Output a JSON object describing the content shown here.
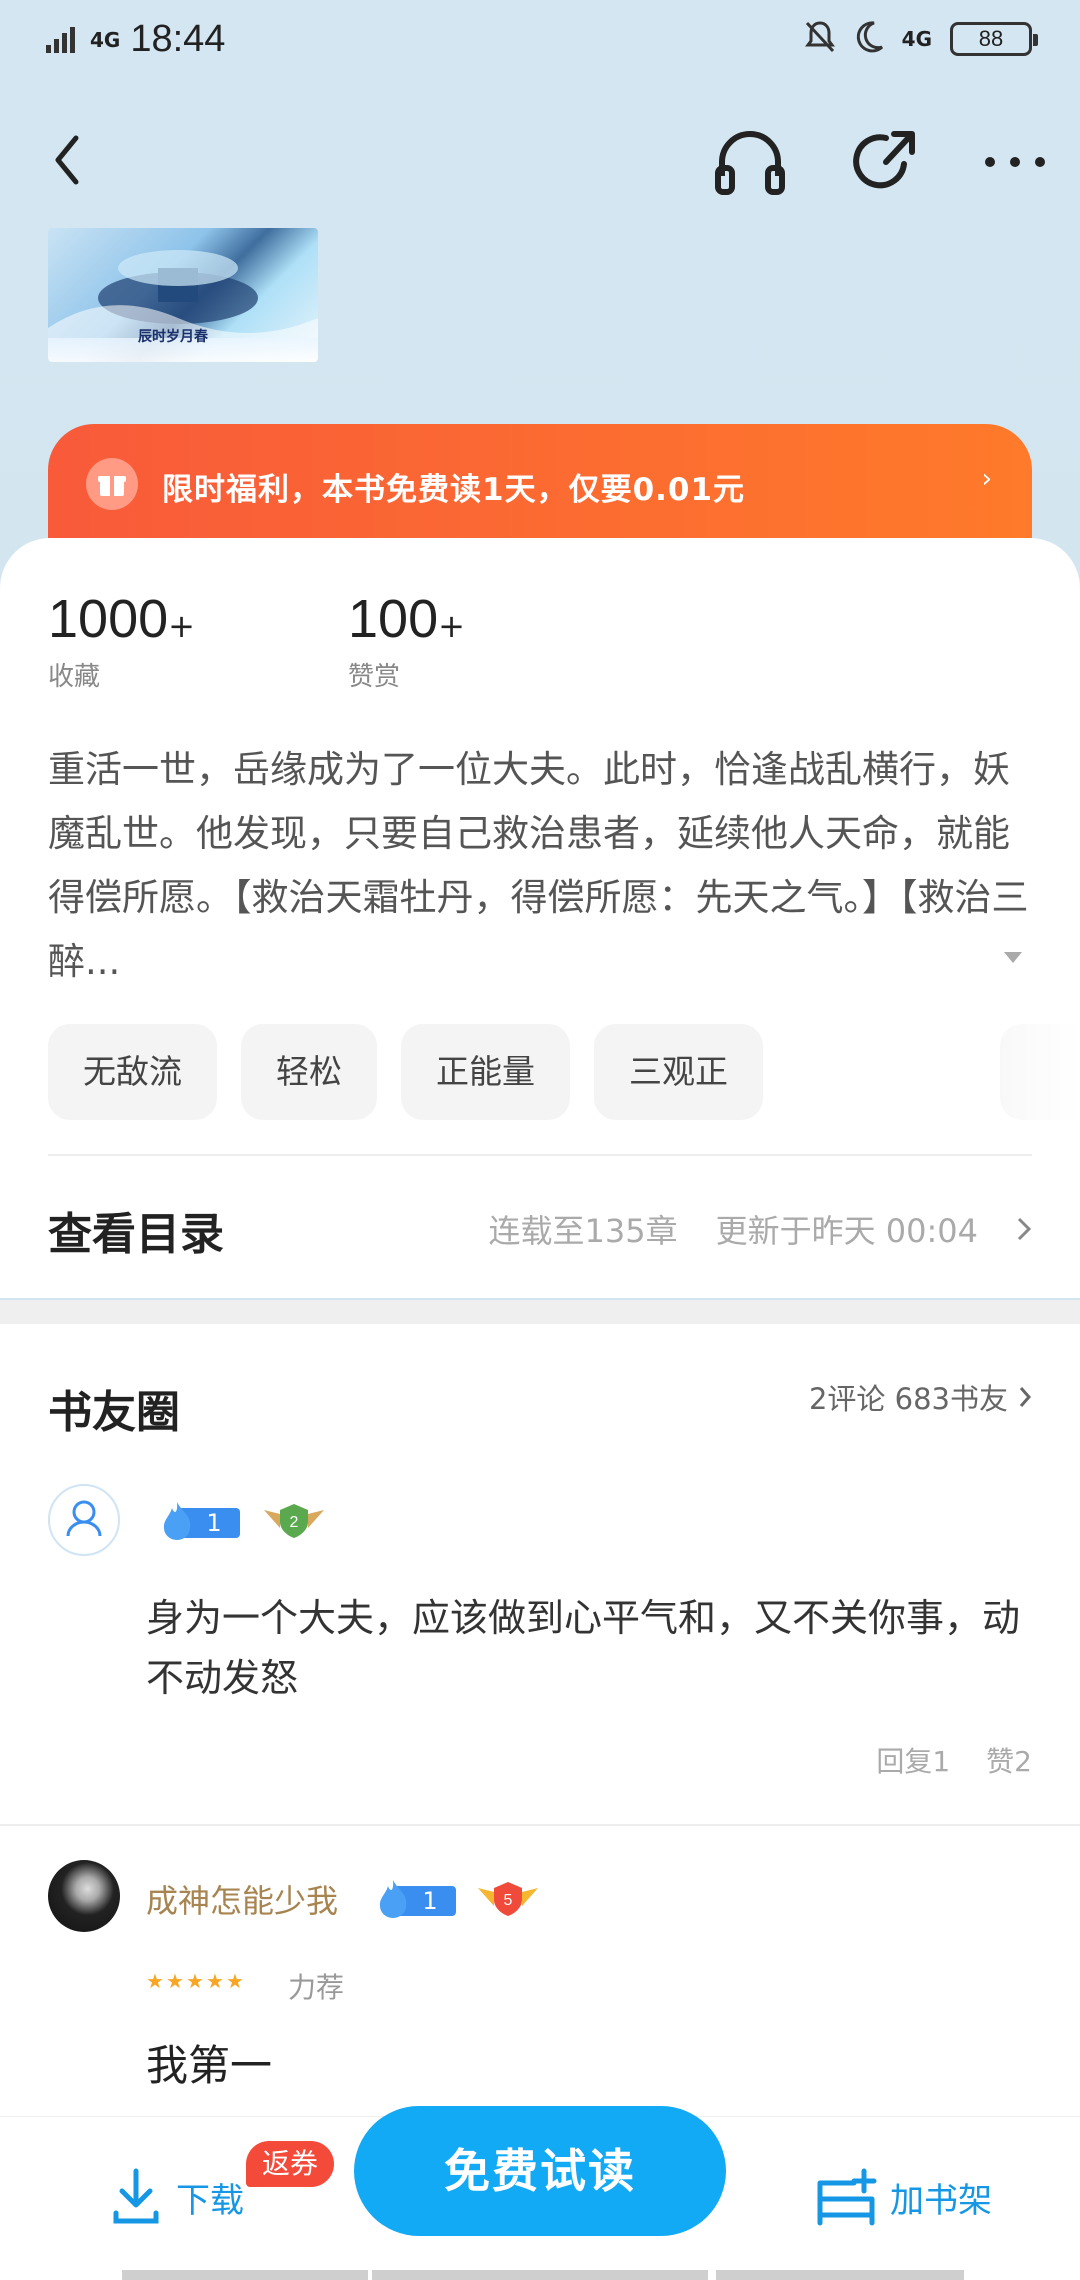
{
  "status_bar": {
    "network_left": "4G",
    "time": "18:44",
    "network_right": "4G",
    "battery": "88"
  },
  "nav": {
    "back_icon": "chevron-left-icon",
    "audio_icon": "headphones-icon",
    "share_icon": "share-icon",
    "more_icon": "more-icon"
  },
  "cover": {
    "title_text": "辰时岁月春"
  },
  "promo": {
    "text": "限时福利，本书免费读1天，仅要0.01元",
    "chevron": "›"
  },
  "stats": [
    {
      "value": "1000",
      "suffix": "+",
      "label": "收藏"
    },
    {
      "value": "100",
      "suffix": "+",
      "label": "赞赏"
    }
  ],
  "synopsis": "重活一世，岳缘成为了一位大夫。此时，恰逢战乱横行，妖魔乱世。他发现，只要自己救治患者，延续他人天命，就能得偿所愿。【救治天霜牡丹，得偿所愿：先天之气。】【救治三醉...",
  "tags": [
    "无敌流",
    "轻松",
    "正能量",
    "三观正"
  ],
  "toc": {
    "title": "查看目录",
    "serial": "连载至135章",
    "updated": "更新于昨天 00:04"
  },
  "circle": {
    "title": "书友圈",
    "meta": "2评论 683书友",
    "comments": [
      {
        "fire_level": "1",
        "rank": "2",
        "text": "身为一个大夫，应该做到心平气和，又不关你事，动不动发怒",
        "reply": "回复1",
        "like": "赞2"
      },
      {
        "username": "成神怎能少我",
        "fire_level": "1",
        "rank": "5",
        "rating_label": "力荐",
        "text": "我第一"
      }
    ]
  },
  "bottom": {
    "download": "下载",
    "coupon": "返券",
    "read": "免费试读",
    "shelf": "加书架"
  },
  "colors": {
    "accent": "#13aaf5",
    "promo_start": "#f85a3a",
    "promo_end": "#ff7a2a",
    "coupon": "#f44a3a",
    "username": "#a78450"
  }
}
